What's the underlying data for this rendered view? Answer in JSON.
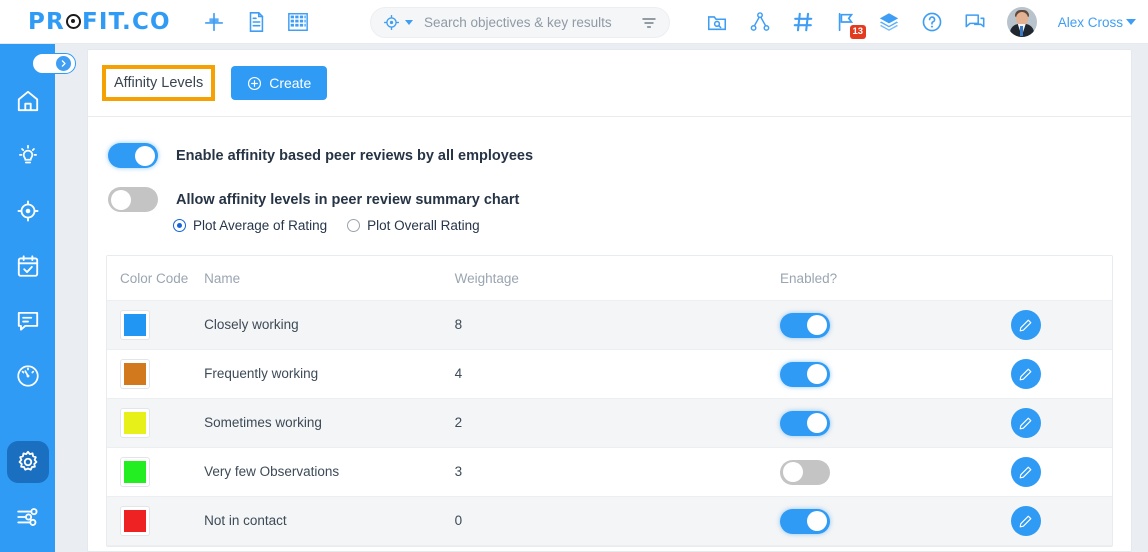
{
  "topbar": {
    "logo_pre": "PR",
    "logo_post": "FIT.CO",
    "nav_icons": [
      {
        "name": "align-icon",
        "label": "Align"
      },
      {
        "name": "document-icon",
        "label": "Documents"
      },
      {
        "name": "grid-icon",
        "label": "Grid"
      }
    ],
    "right_icons": [
      {
        "name": "folder-search-icon",
        "label": "Search Folder"
      },
      {
        "name": "org-chart-icon",
        "label": "Org Chart"
      },
      {
        "name": "hash-icon",
        "label": "Channels"
      },
      {
        "name": "flag-icon",
        "label": "Flags",
        "badge": "13"
      },
      {
        "name": "layers-icon",
        "label": "Layers"
      },
      {
        "name": "help-icon",
        "label": "Help"
      },
      {
        "name": "chat-icon",
        "label": "Chat"
      }
    ],
    "user": {
      "name": "Alex Cross",
      "avatar_name": "user-avatar"
    }
  },
  "search": {
    "placeholder": "Search objectives & key results",
    "value": "",
    "scope_icon": "target-icon",
    "filter_icon": "filter-icon"
  },
  "sidebar": {
    "expand_label": "Expand sidebar",
    "items": [
      {
        "name": "sidebar-item-home",
        "icon": "home-icon",
        "active": false
      },
      {
        "name": "sidebar-item-ideas",
        "icon": "lightbulb-icon",
        "active": false
      },
      {
        "name": "sidebar-item-objectives",
        "icon": "target-icon",
        "active": false
      },
      {
        "name": "sidebar-item-tasks",
        "icon": "calendar-check-icon",
        "active": false
      },
      {
        "name": "sidebar-item-feedback",
        "icon": "chat-bubble-icon",
        "active": false
      },
      {
        "name": "sidebar-item-performance",
        "icon": "gauge-icon",
        "active": false
      },
      {
        "name": "sidebar-item-settings",
        "icon": "gear-icon",
        "active": true
      },
      {
        "name": "sidebar-item-configure",
        "icon": "sliders-icon",
        "active": false
      }
    ]
  },
  "content": {
    "tab_label": "Affinity Levels",
    "create_label": "Create",
    "create_icon": "plus-circle-icon",
    "settings": {
      "enable_peer_reviews": {
        "label": "Enable affinity based peer reviews by all employees",
        "state": "on"
      },
      "allow_affinity_chart": {
        "label": "Allow affinity levels in peer review summary chart",
        "state": "off"
      },
      "plot_options": [
        {
          "label": "Plot Average of Rating",
          "selected": true
        },
        {
          "label": "Plot Overall Rating",
          "selected": false
        }
      ]
    },
    "table": {
      "headers": [
        "Color Code",
        "Name",
        "Weightage",
        "Enabled?",
        ""
      ],
      "rows": [
        {
          "color": "#2196f3",
          "name": "Closely working",
          "weightage": "8",
          "enabled": "on",
          "edit_icon": "pencil-icon"
        },
        {
          "color": "#d2791e",
          "name": "Frequently working",
          "weightage": "4",
          "enabled": "on",
          "edit_icon": "pencil-icon"
        },
        {
          "color": "#e8f019",
          "name": "Sometimes working",
          "weightage": "2",
          "enabled": "on",
          "edit_icon": "pencil-icon"
        },
        {
          "color": "#22ee22",
          "name": "Very few Observations",
          "weightage": "3",
          "enabled": "off",
          "edit_icon": "pencil-icon"
        },
        {
          "color": "#ee2222",
          "name": "Not in contact",
          "weightage": "0",
          "enabled": "on",
          "edit_icon": "pencil-icon"
        }
      ]
    }
  },
  "colors": {
    "brand_blue": "#2f9bf5",
    "sidebar_active": "#1b6fc0",
    "highlight_orange": "#f5a003",
    "badge_red": "#e33b20"
  }
}
